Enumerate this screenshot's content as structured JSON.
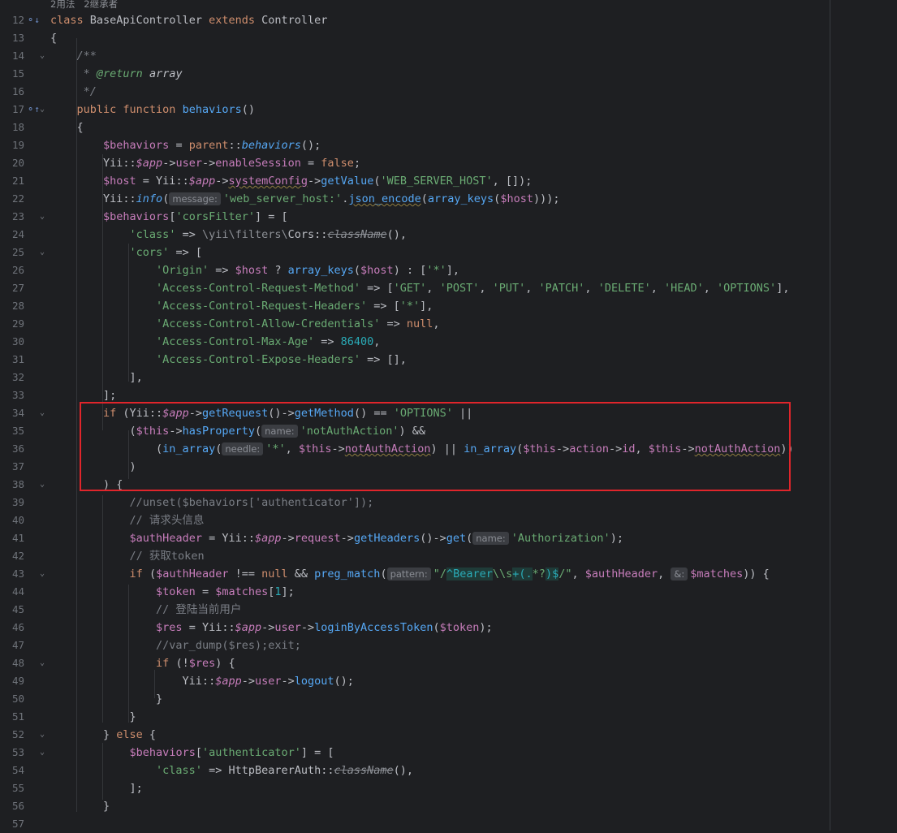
{
  "editor": {
    "usage_hint": "2用法   2继承者",
    "lines": [
      {
        "n": "12",
        "icon": "⚬↓",
        "fold": ""
      },
      {
        "n": "13",
        "icon": "",
        "fold": ""
      },
      {
        "n": "14",
        "icon": "",
        "fold": "⌄"
      },
      {
        "n": "15",
        "icon": "",
        "fold": ""
      },
      {
        "n": "16",
        "icon": "",
        "fold": ""
      },
      {
        "n": "17",
        "icon": "⚬↑",
        "fold": "⌄"
      },
      {
        "n": "18",
        "icon": "",
        "fold": ""
      },
      {
        "n": "19",
        "icon": "",
        "fold": ""
      },
      {
        "n": "20",
        "icon": "",
        "fold": ""
      },
      {
        "n": "21",
        "icon": "",
        "fold": ""
      },
      {
        "n": "22",
        "icon": "",
        "fold": ""
      },
      {
        "n": "23",
        "icon": "",
        "fold": "⌄"
      },
      {
        "n": "24",
        "icon": "",
        "fold": ""
      },
      {
        "n": "25",
        "icon": "",
        "fold": "⌄"
      },
      {
        "n": "26",
        "icon": "",
        "fold": ""
      },
      {
        "n": "27",
        "icon": "",
        "fold": ""
      },
      {
        "n": "28",
        "icon": "",
        "fold": ""
      },
      {
        "n": "29",
        "icon": "",
        "fold": ""
      },
      {
        "n": "30",
        "icon": "",
        "fold": ""
      },
      {
        "n": "31",
        "icon": "",
        "fold": ""
      },
      {
        "n": "32",
        "icon": "",
        "fold": ""
      },
      {
        "n": "33",
        "icon": "",
        "fold": ""
      },
      {
        "n": "34",
        "icon": "",
        "fold": "⌄"
      },
      {
        "n": "35",
        "icon": "",
        "fold": ""
      },
      {
        "n": "36",
        "icon": "",
        "fold": ""
      },
      {
        "n": "37",
        "icon": "",
        "fold": ""
      },
      {
        "n": "38",
        "icon": "",
        "fold": "⌄"
      },
      {
        "n": "39",
        "icon": "",
        "fold": ""
      },
      {
        "n": "40",
        "icon": "",
        "fold": ""
      },
      {
        "n": "41",
        "icon": "",
        "fold": ""
      },
      {
        "n": "42",
        "icon": "",
        "fold": ""
      },
      {
        "n": "43",
        "icon": "",
        "fold": "⌄"
      },
      {
        "n": "44",
        "icon": "",
        "fold": ""
      },
      {
        "n": "45",
        "icon": "",
        "fold": ""
      },
      {
        "n": "46",
        "icon": "",
        "fold": ""
      },
      {
        "n": "47",
        "icon": "",
        "fold": ""
      },
      {
        "n": "48",
        "icon": "",
        "fold": "⌄"
      },
      {
        "n": "49",
        "icon": "",
        "fold": ""
      },
      {
        "n": "50",
        "icon": "",
        "fold": ""
      },
      {
        "n": "51",
        "icon": "",
        "fold": ""
      },
      {
        "n": "52",
        "icon": "",
        "fold": "⌄"
      },
      {
        "n": "53",
        "icon": "",
        "fold": "⌄"
      },
      {
        "n": "54",
        "icon": "",
        "fold": ""
      },
      {
        "n": "55",
        "icon": "",
        "fold": ""
      },
      {
        "n": "56",
        "icon": "",
        "fold": ""
      },
      {
        "n": "57",
        "icon": "",
        "fold": ""
      }
    ],
    "code": [
      [
        [
          "kw",
          "class "
        ],
        [
          "",
          "BaseApiController "
        ],
        [
          "kw",
          "extends "
        ],
        [
          "",
          "Controller"
        ]
      ],
      [
        [
          "",
          "{"
        ]
      ],
      [
        [
          "",
          "    "
        ],
        [
          "cmi",
          "/**"
        ]
      ],
      [
        [
          "",
          "    "
        ],
        [
          "cmi",
          " * "
        ],
        [
          "ptag",
          "@return "
        ],
        [
          "ptype",
          "array"
        ]
      ],
      [
        [
          "",
          "    "
        ],
        [
          "cmi",
          " */"
        ]
      ],
      [
        [
          "",
          "    "
        ],
        [
          "kw",
          "public function "
        ],
        [
          "fn",
          "behaviors"
        ],
        [
          "",
          "()"
        ]
      ],
      [
        [
          "",
          "    {"
        ]
      ],
      [
        [
          "",
          "        "
        ],
        [
          "var",
          "$behaviors"
        ],
        [
          "",
          " = "
        ],
        [
          "kw",
          "parent"
        ],
        [
          "",
          "::"
        ],
        [
          "sti",
          "behaviors"
        ],
        [
          "",
          "();"
        ]
      ],
      [
        [
          "",
          "        Yii::"
        ],
        [
          "vari",
          "$app"
        ],
        [
          "",
          "->"
        ],
        [
          "var",
          "user"
        ],
        [
          "",
          "->"
        ],
        [
          "var",
          "enableSession"
        ],
        [
          "",
          " = "
        ],
        [
          "kw",
          "false"
        ],
        [
          "",
          ";"
        ]
      ],
      [
        [
          "",
          "        "
        ],
        [
          "var",
          "$host"
        ],
        [
          "",
          " = Yii::"
        ],
        [
          "vari",
          "$app"
        ],
        [
          "",
          "->"
        ],
        [
          "var uw",
          "systemConfig"
        ],
        [
          "",
          "->"
        ],
        [
          "fn",
          "getValue"
        ],
        [
          "",
          "("
        ],
        [
          "str",
          "'WEB_SERVER_HOST'"
        ],
        [
          "",
          ", []);"
        ]
      ],
      [
        [
          "",
          "        Yii::"
        ],
        [
          "sti",
          "info"
        ],
        [
          "",
          "("
        ],
        [
          "hint",
          "message:"
        ],
        [
          "str",
          "'web_server_host:'"
        ],
        [
          "",
          "."
        ],
        [
          "fn uw",
          "json_encode"
        ],
        [
          "",
          "("
        ],
        [
          "fn",
          "array_keys"
        ],
        [
          "",
          "("
        ],
        [
          "var",
          "$host"
        ],
        [
          "",
          ")));"
        ]
      ],
      [
        [
          "",
          "        "
        ],
        [
          "var",
          "$behaviors"
        ],
        [
          "",
          "["
        ],
        [
          "str",
          "'corsFilter'"
        ],
        [
          "",
          "] = ["
        ]
      ],
      [
        [
          "",
          "            "
        ],
        [
          "str",
          "'class'"
        ],
        [
          "",
          " => "
        ],
        [
          "ns",
          "\\yii\\filters\\"
        ],
        [
          "",
          "Cors::"
        ],
        [
          "dep",
          "className"
        ],
        [
          "",
          "(),"
        ]
      ],
      [
        [
          "",
          "            "
        ],
        [
          "str",
          "'cors'"
        ],
        [
          "",
          " => ["
        ]
      ],
      [
        [
          "",
          "                "
        ],
        [
          "str",
          "'Origin'"
        ],
        [
          "",
          " => "
        ],
        [
          "var",
          "$host"
        ],
        [
          "",
          " ? "
        ],
        [
          "fn",
          "array_keys"
        ],
        [
          "",
          "("
        ],
        [
          "var",
          "$host"
        ],
        [
          "",
          ") : ["
        ],
        [
          "str",
          "'*'"
        ],
        [
          "",
          "],"
        ]
      ],
      [
        [
          "",
          "                "
        ],
        [
          "str",
          "'Access-Control-Request-Method'"
        ],
        [
          "",
          " => ["
        ],
        [
          "str",
          "'GET'"
        ],
        [
          "",
          ", "
        ],
        [
          "str",
          "'POST'"
        ],
        [
          "",
          ", "
        ],
        [
          "str",
          "'PUT'"
        ],
        [
          "",
          ", "
        ],
        [
          "str",
          "'PATCH'"
        ],
        [
          "",
          ", "
        ],
        [
          "str",
          "'DELETE'"
        ],
        [
          "",
          ", "
        ],
        [
          "str",
          "'HEAD'"
        ],
        [
          "",
          ", "
        ],
        [
          "str",
          "'OPTIONS'"
        ],
        [
          "",
          "],"
        ]
      ],
      [
        [
          "",
          "                "
        ],
        [
          "str",
          "'Access-Control-Request-Headers'"
        ],
        [
          "",
          " => ["
        ],
        [
          "str",
          "'*'"
        ],
        [
          "",
          "],"
        ]
      ],
      [
        [
          "",
          "                "
        ],
        [
          "str",
          "'Access-Control-Allow-Credentials'"
        ],
        [
          "",
          " => "
        ],
        [
          "kw",
          "null"
        ],
        [
          "",
          ","
        ]
      ],
      [
        [
          "",
          "                "
        ],
        [
          "str",
          "'Access-Control-Max-Age'"
        ],
        [
          "",
          " => "
        ],
        [
          "num",
          "86400"
        ],
        [
          "",
          ","
        ]
      ],
      [
        [
          "",
          "                "
        ],
        [
          "str",
          "'Access-Control-Expose-Headers'"
        ],
        [
          "",
          " => [],"
        ]
      ],
      [
        [
          "",
          "            ],"
        ]
      ],
      [
        [
          "",
          "        ];"
        ]
      ],
      [
        [
          "",
          "        "
        ],
        [
          "kw",
          "if "
        ],
        [
          "",
          "(Yii::"
        ],
        [
          "vari",
          "$app"
        ],
        [
          "",
          "->"
        ],
        [
          "fn",
          "getRequest"
        ],
        [
          "",
          "()->"
        ],
        [
          "fn",
          "getMethod"
        ],
        [
          "",
          "() == "
        ],
        [
          "str",
          "'OPTIONS'"
        ],
        [
          "",
          " ||"
        ]
      ],
      [
        [
          "",
          "            ("
        ],
        [
          "var",
          "$this"
        ],
        [
          "",
          "->"
        ],
        [
          "fn",
          "hasProperty"
        ],
        [
          "",
          "("
        ],
        [
          "hint",
          "name:"
        ],
        [
          "str",
          "'notAuthAction'"
        ],
        [
          "",
          ") &&"
        ]
      ],
      [
        [
          "",
          "                ("
        ],
        [
          "fn",
          "in_array"
        ],
        [
          "",
          "("
        ],
        [
          "hint",
          "needle:"
        ],
        [
          "str",
          "'*'"
        ],
        [
          "",
          ", "
        ],
        [
          "var",
          "$this"
        ],
        [
          "",
          "->"
        ],
        [
          "var uw",
          "notAuthAction"
        ],
        [
          "",
          ") || "
        ],
        [
          "fn",
          "in_array"
        ],
        [
          "",
          "("
        ],
        [
          "var",
          "$this"
        ],
        [
          "",
          "->"
        ],
        [
          "var",
          "action"
        ],
        [
          "",
          "->"
        ],
        [
          "var",
          "id"
        ],
        [
          "",
          ", "
        ],
        [
          "var",
          "$this"
        ],
        [
          "",
          "->"
        ],
        [
          "var uw",
          "notAuthAction"
        ],
        [
          "",
          "))"
        ]
      ],
      [
        [
          "",
          "            )"
        ]
      ],
      [
        [
          "",
          "        ) {"
        ]
      ],
      [
        [
          "",
          "            "
        ],
        [
          "cm",
          "//unset($behaviors['authenticator']);"
        ]
      ],
      [
        [
          "",
          "            "
        ],
        [
          "cm",
          "// 请求头信息"
        ]
      ],
      [
        [
          "",
          "            "
        ],
        [
          "var",
          "$authHeader"
        ],
        [
          "",
          " = Yii::"
        ],
        [
          "vari",
          "$app"
        ],
        [
          "",
          "->"
        ],
        [
          "var",
          "request"
        ],
        [
          "",
          "->"
        ],
        [
          "fn",
          "getHeaders"
        ],
        [
          "",
          "()->"
        ],
        [
          "fn",
          "get"
        ],
        [
          "",
          "("
        ],
        [
          "hint",
          "name:"
        ],
        [
          "str",
          "'Authorization'"
        ],
        [
          "",
          ");"
        ]
      ],
      [
        [
          "",
          "            "
        ],
        [
          "cm",
          "// 获取token"
        ]
      ],
      [
        [
          "",
          "            "
        ],
        [
          "kw",
          "if "
        ],
        [
          "",
          "("
        ],
        [
          "var",
          "$authHeader"
        ],
        [
          "",
          " !== "
        ],
        [
          "kw",
          "null"
        ],
        [
          "",
          " && "
        ],
        [
          "fn",
          "preg_match"
        ],
        [
          "",
          "("
        ],
        [
          "hint",
          "pattern:"
        ],
        [
          "str",
          "\"/"
        ],
        [
          "rx",
          "^Bearer"
        ],
        [
          "rxp",
          "\\\\s"
        ],
        [
          "rx",
          "+(."
        ],
        [
          "rxp",
          "*?"
        ],
        [
          "rx",
          ")$"
        ],
        [
          "str",
          "/\""
        ],
        [
          "",
          ", "
        ],
        [
          "var",
          "$authHeader"
        ],
        [
          "",
          ", "
        ],
        [
          "hint",
          "&:"
        ],
        [
          "var",
          "$matches"
        ],
        [
          "",
          ")) {"
        ]
      ],
      [
        [
          "",
          "                "
        ],
        [
          "var",
          "$token"
        ],
        [
          "",
          " = "
        ],
        [
          "var",
          "$matches"
        ],
        [
          "",
          "["
        ],
        [
          "num",
          "1"
        ],
        [
          "",
          "];"
        ]
      ],
      [
        [
          "",
          "                "
        ],
        [
          "cm",
          "// 登陆当前用户"
        ]
      ],
      [
        [
          "",
          "                "
        ],
        [
          "var",
          "$res"
        ],
        [
          "",
          " = Yii::"
        ],
        [
          "vari",
          "$app"
        ],
        [
          "",
          "->"
        ],
        [
          "var",
          "user"
        ],
        [
          "",
          "->"
        ],
        [
          "fn",
          "loginByAccessToken"
        ],
        [
          "",
          "("
        ],
        [
          "var",
          "$token"
        ],
        [
          "",
          ");"
        ]
      ],
      [
        [
          "",
          "                "
        ],
        [
          "cm",
          "//var_dump($res);exit;"
        ]
      ],
      [
        [
          "",
          "                "
        ],
        [
          "kw",
          "if "
        ],
        [
          "",
          "(!"
        ],
        [
          "var",
          "$res"
        ],
        [
          "",
          ") {"
        ]
      ],
      [
        [
          "",
          "                    Yii::"
        ],
        [
          "vari",
          "$app"
        ],
        [
          "",
          "->"
        ],
        [
          "var",
          "user"
        ],
        [
          "",
          "->"
        ],
        [
          "fn",
          "logout"
        ],
        [
          "",
          "();"
        ]
      ],
      [
        [
          "",
          "                }"
        ]
      ],
      [
        [
          "",
          "            }"
        ]
      ],
      [
        [
          "",
          "        } "
        ],
        [
          "kw",
          "else "
        ],
        [
          "",
          "{"
        ]
      ],
      [
        [
          "",
          "            "
        ],
        [
          "var",
          "$behaviors"
        ],
        [
          "",
          "["
        ],
        [
          "str",
          "'authenticator'"
        ],
        [
          "",
          "] = ["
        ]
      ],
      [
        [
          "",
          "                "
        ],
        [
          "str",
          "'class'"
        ],
        [
          "",
          " => HttpBearerAuth::"
        ],
        [
          "dep",
          "className"
        ],
        [
          "",
          "(),"
        ]
      ],
      [
        [
          "",
          "            ];"
        ]
      ],
      [
        [
          "",
          "        }"
        ]
      ],
      [
        [
          "",
          ""
        ]
      ]
    ]
  }
}
